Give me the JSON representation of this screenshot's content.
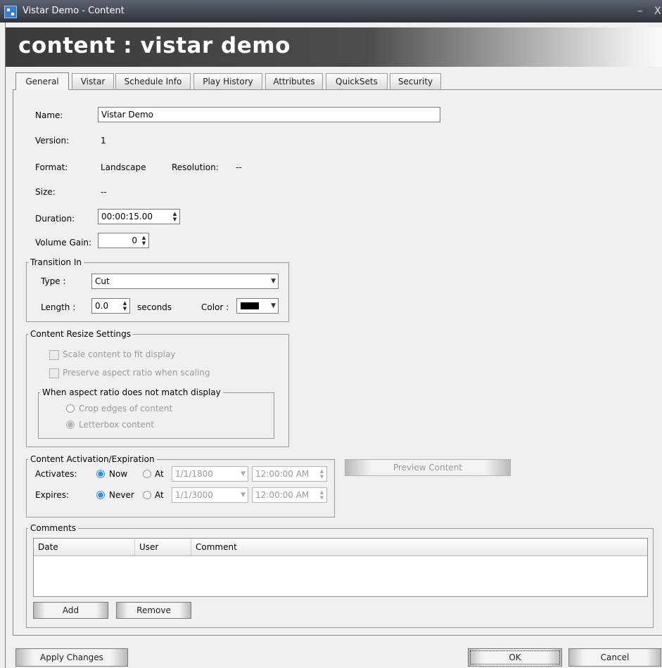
{
  "window": {
    "title": "Vistar Demo - Content",
    "minimize": "–",
    "close": "X"
  },
  "banner": {
    "title": "content : vistar demo"
  },
  "tabs": [
    "General",
    "Vistar",
    "Schedule Info",
    "Play History",
    "Attributes",
    "QuickSets",
    "Security"
  ],
  "general": {
    "name_label": "Name:",
    "name_value": "Vistar Demo",
    "version_label": "Version:",
    "version_value": "1",
    "format_label": "Format:",
    "format_value": "Landscape",
    "resolution_label": "Resolution:",
    "resolution_value": "--",
    "size_label": "Size:",
    "size_value": "--",
    "duration_label": "Duration:",
    "duration_value": "00:00:15.00",
    "volume_label": "Volume Gain:",
    "volume_value": "0"
  },
  "transition": {
    "legend": "Transition In",
    "type_label": "Type :",
    "type_value": "Cut",
    "length_label": "Length :",
    "length_value": "0.0",
    "seconds_label": "seconds",
    "color_label": "Color :",
    "color_value": "#000000"
  },
  "resize": {
    "legend": "Content Resize Settings",
    "scale_label": "Scale content to fit display",
    "preserve_label": "Preserve aspect ratio when scaling",
    "aspect_legend": "When aspect ratio does not match display",
    "crop_label": "Crop edges of content",
    "letterbox_label": "Letterbox content"
  },
  "activation": {
    "legend": "Content Activation/Expiration",
    "activates_label": "Activates:",
    "now_label": "Now",
    "at_label": "At",
    "activates_date": "1/1/1800",
    "activates_time": "12:00:00 AM",
    "expires_label": "Expires:",
    "never_label": "Never",
    "at2_label": "At",
    "expires_date": "1/1/3000",
    "expires_time": "12:00:00 AM",
    "preview_button": "Preview Content"
  },
  "comments": {
    "legend": "Comments",
    "columns": [
      "Date",
      "User",
      "Comment"
    ],
    "add_button": "Add",
    "remove_button": "Remove"
  },
  "footer": {
    "apply_button": "Apply Changes",
    "ok_button": "OK",
    "cancel_button": "Cancel"
  }
}
